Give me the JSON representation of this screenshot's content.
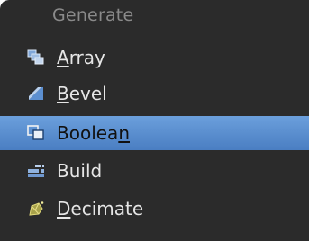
{
  "menu": {
    "header": "Generate",
    "items": [
      {
        "pre": "",
        "ul": "A",
        "post": "rray",
        "icon": "array-icon",
        "active": false
      },
      {
        "pre": "",
        "ul": "B",
        "post": "evel",
        "icon": "bevel-icon",
        "active": false
      },
      {
        "pre": "Boolea",
        "ul": "n",
        "post": "",
        "icon": "boolean-icon",
        "active": true
      },
      {
        "pre": "Build",
        "ul": "",
        "post": "",
        "icon": "build-icon",
        "active": false
      },
      {
        "pre": "",
        "ul": "D",
        "post": "ecimate",
        "icon": "decimate-icon",
        "active": false
      }
    ]
  }
}
